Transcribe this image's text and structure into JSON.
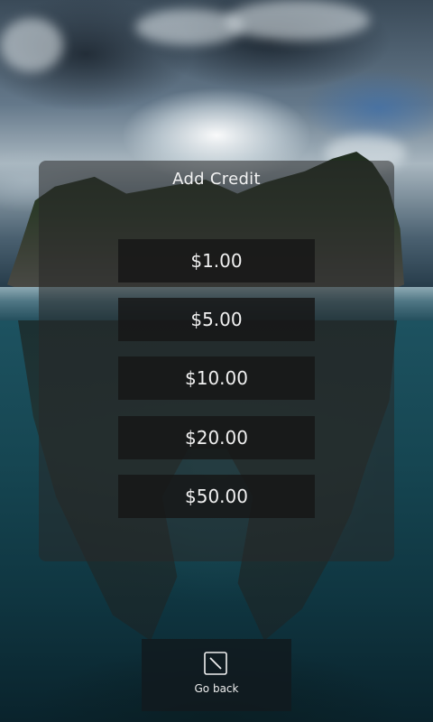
{
  "dialog": {
    "title": "Add Credit"
  },
  "amounts": [
    {
      "label": "$1.00"
    },
    {
      "label": "$5.00"
    },
    {
      "label": "$10.00"
    },
    {
      "label": "$20.00"
    },
    {
      "label": "$50.00"
    }
  ],
  "back": {
    "label": "Go back",
    "icon": "back-square-icon"
  },
  "colors": {
    "button_bg": "#161616",
    "text": "#f0f0f0",
    "sea": "#164652"
  }
}
